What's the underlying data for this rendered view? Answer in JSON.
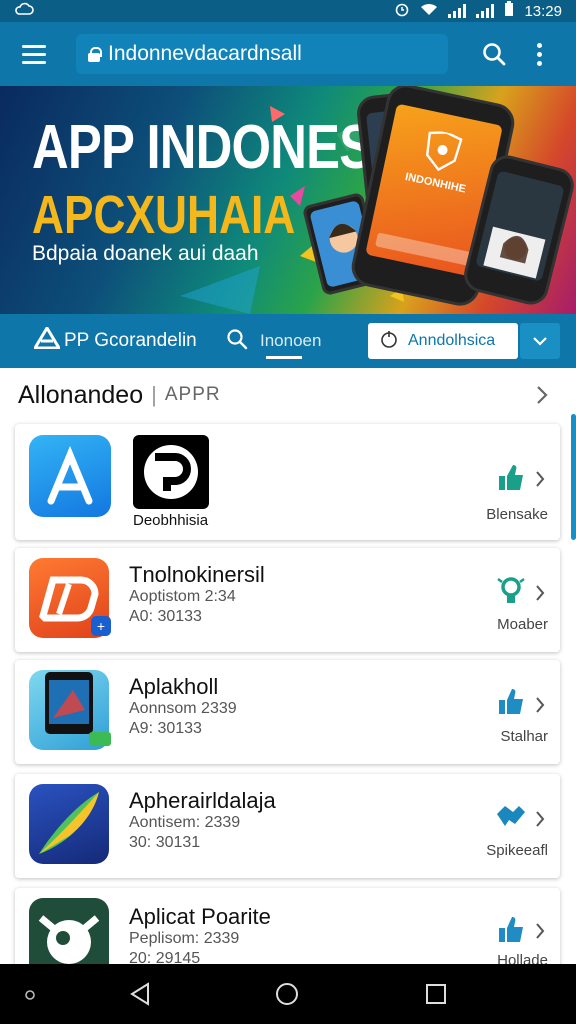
{
  "status_bar": {
    "time": "13:29"
  },
  "header": {
    "url": "Indonnevdacardnsall"
  },
  "banner": {
    "title": "APP INDONESI",
    "subtitle": "APCXUHAIA",
    "tagline": "Bdpaia doanek aui daah",
    "phone_label": "INDONHIHE"
  },
  "tab_strip": {
    "brand": "PP Gcorandelin",
    "search_tab": "Inonoen",
    "select_value": "Anndolhsica"
  },
  "section": {
    "title": "Allonandeo",
    "subtitle": "APPR"
  },
  "apps": [
    {
      "name": "Deobhhisia",
      "meta1": "",
      "meta2": "",
      "action_label": "Blensake",
      "icon": "app-store-icon",
      "action_icon": "thumbs-up-icon",
      "color": "#1aa0e8"
    },
    {
      "name": "Tnolnokinersil",
      "meta1": "Aoptistom 2:34",
      "meta2": "A0: 30133",
      "action_label": "Moaber",
      "icon": "orange-app-icon",
      "action_icon": "lightbulb-icon",
      "color": "#ef5a24"
    },
    {
      "name": "Aplakholl",
      "meta1": "Aonnsom 2339",
      "meta2": "A9: 30133",
      "action_label": "Stalhar",
      "icon": "tablet-app-icon",
      "action_icon": "thumbs-up-icon",
      "color": "#2f9fd6"
    },
    {
      "name": "Apherairldalaja",
      "meta1": "Aontisem: 2339",
      "meta2": "30: 30131",
      "action_label": "Spikeeafl",
      "icon": "leaf-app-icon",
      "action_icon": "handshake-icon",
      "color": "#1b3fa0"
    },
    {
      "name": "Aplicat Poarite",
      "meta1": "Peplisom: 2339",
      "meta2": "20: 29145",
      "action_label": "Hollade",
      "icon": "robot-app-icon",
      "action_icon": "thumbs-up-icon",
      "color": "#1f4d3a"
    }
  ],
  "colors": {
    "primary": "#0e76a8",
    "accent": "#1aa08a",
    "banner_yellow": "#f5b81c"
  }
}
